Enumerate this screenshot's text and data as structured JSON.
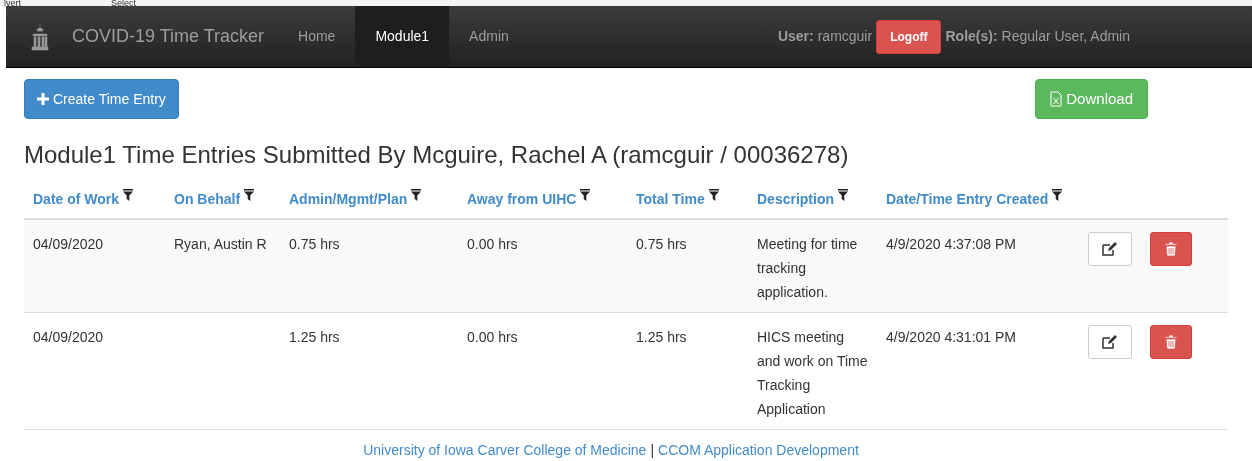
{
  "top_strip": [
    "lvert",
    "Select"
  ],
  "navbar": {
    "brand": "COVID-19 Time Tracker",
    "links": [
      {
        "label": "Home",
        "selected": false
      },
      {
        "label": "Module1",
        "selected": true
      },
      {
        "label": "Admin",
        "selected": false
      }
    ],
    "user_label": "User:",
    "user": "ramcguir",
    "logoff": "Logoff",
    "roles_label": "Role(s):",
    "roles": "Regular User, Admin"
  },
  "actions": {
    "create": "Create Time Entry",
    "download": "Download"
  },
  "heading": "Module1 Time Entries Submitted By Mcguire, Rachel A (ramcguir / 00036278)",
  "table": {
    "columns": [
      "Date of Work",
      "On Behalf",
      "Admin/Mgmt/Plan",
      "Away from UIHC",
      "Total Time",
      "Description",
      "Date/Time Entry Created"
    ],
    "rows": [
      {
        "cells": [
          "04/09/2020",
          "Ryan, Austin R",
          "0.75 hrs",
          "0.00 hrs",
          "0.75 hrs",
          "Meeting for time tracking application.",
          "4/9/2020 4:37:08 PM"
        ]
      },
      {
        "cells": [
          "04/09/2020",
          "",
          "1.25 hrs",
          "0.00 hrs",
          "1.25 hrs",
          "HICS meeting and work on Time Tracking Application",
          "4/9/2020 4:31:01 PM"
        ]
      }
    ]
  },
  "footer": {
    "links": [
      "University of Iowa Carver College of Medicine",
      "CCOM Application Development"
    ],
    "separator": "|"
  }
}
